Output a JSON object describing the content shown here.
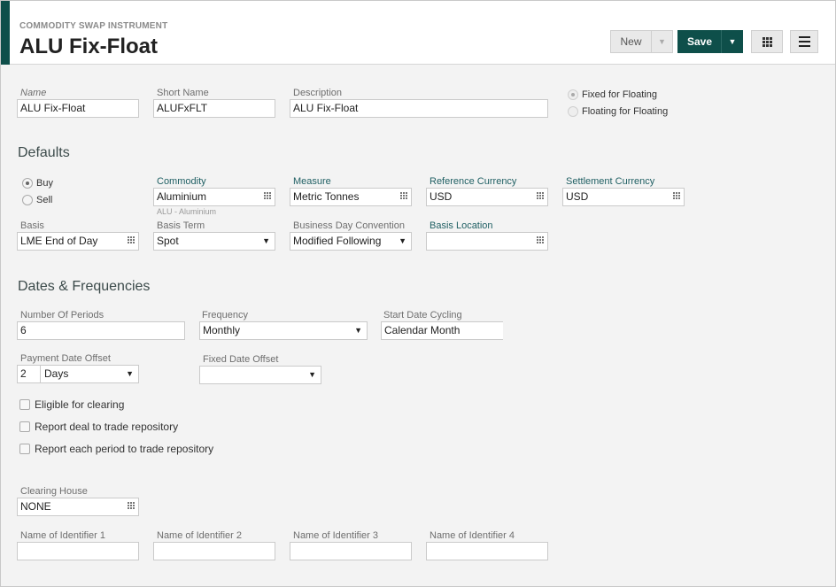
{
  "header": {
    "subtitle": "COMMODITY SWAP INSTRUMENT",
    "title": "ALU Fix-Float",
    "new_label": "New",
    "save_label": "Save"
  },
  "general": {
    "name_label": "Name",
    "name_value": "ALU Fix-Float",
    "short_name_label": "Short Name",
    "short_name_value": "ALUFxFLT",
    "description_label": "Description",
    "description_value": "ALU Fix-Float",
    "swap_type_options": [
      "Fixed for Floating",
      "Floating for Floating"
    ],
    "swap_type_selected": "Fixed for Floating"
  },
  "defaults": {
    "section_title": "Defaults",
    "direction_options": [
      "Buy",
      "Sell"
    ],
    "direction_selected": "Buy",
    "commodity_label": "Commodity",
    "commodity_value": "Aluminium",
    "commodity_hint": "ALU - Aluminium",
    "measure_label": "Measure",
    "measure_value": "Metric Tonnes",
    "ref_currency_label": "Reference Currency",
    "ref_currency_value": "USD",
    "settle_currency_label": "Settlement Currency",
    "settle_currency_value": "USD",
    "basis_label": "Basis",
    "basis_value": "LME End of Day",
    "basis_term_label": "Basis Term",
    "basis_term_value": "Spot",
    "bdc_label": "Business Day Convention",
    "bdc_value": "Modified Following",
    "basis_location_label": "Basis Location",
    "basis_location_value": ""
  },
  "dates": {
    "section_title": "Dates & Frequencies",
    "periods_label": "Number Of Periods",
    "periods_value": "6",
    "frequency_label": "Frequency",
    "frequency_value": "Monthly",
    "cycling_label": "Start Date Cycling",
    "cycling_value": "Calendar Month",
    "payment_offset_label": "Payment Date Offset",
    "payment_offset_num": "2",
    "payment_offset_unit": "Days",
    "fixed_offset_label": "Fixed Date Offset",
    "fixed_offset_value": "",
    "checkboxes": [
      "Eligible for clearing",
      "Report deal to trade repository",
      "Report each period to trade repository"
    ]
  },
  "clearing": {
    "clearing_house_label": "Clearing House",
    "clearing_house_value": "NONE",
    "identifier_labels": [
      "Name of Identifier 1",
      "Name of Identifier 2",
      "Name of Identifier 3",
      "Name of Identifier 4"
    ]
  },
  "icons": {
    "picker": "grid-picker-icon",
    "dropdown": "caret-down-icon",
    "view": "grid-view-icon",
    "menu": "hamburger-menu-icon"
  },
  "colors": {
    "accent": "#0e4f4a",
    "label_teal": "#1f5f63",
    "background": "#f3f3f3"
  }
}
